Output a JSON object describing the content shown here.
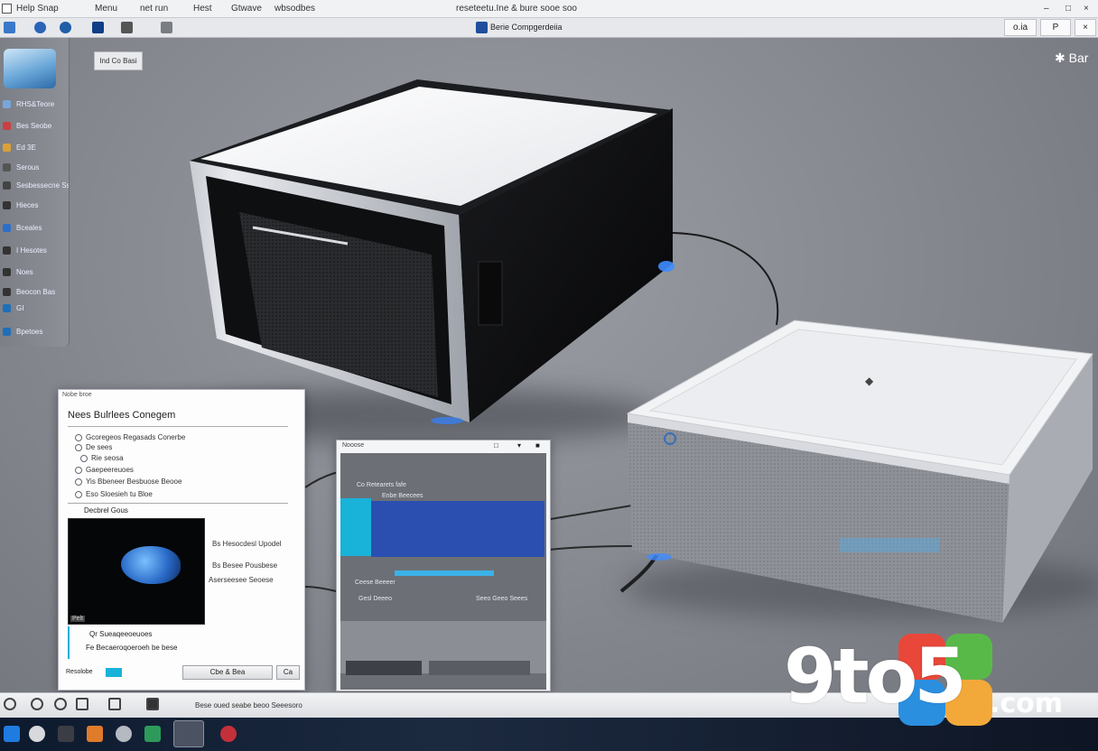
{
  "menubar": {
    "items": [
      "Help Snap",
      "Menu",
      "net run",
      "Hest",
      "Gtwave",
      "wbsodbes"
    ],
    "title": "reseteetu.Ine & bure sooe soo"
  },
  "toolbar": {
    "center_label": "Berie Compgerdeiia",
    "right_dropdown": "o.ia",
    "right_btn2": "P",
    "right_btn3": "×"
  },
  "sidebar": {
    "items": [
      {
        "label": "RHS&Teore",
        "icon_color": "#7aa6d8"
      },
      {
        "label": "Bes Seobe",
        "icon_color": "#c94040"
      },
      {
        "label": "Ed 3E",
        "icon_color": "#d9a13a"
      },
      {
        "label": "Serous",
        "icon_color": "#555"
      },
      {
        "label": "Sesbessecne Ssesce",
        "icon_color": "#444"
      },
      {
        "label": "Hieces",
        "icon_color": "#333"
      },
      {
        "label": "Bceales",
        "icon_color": "#2c6fc9"
      },
      {
        "label": "I Hesotes",
        "icon_color": "#333"
      },
      {
        "label": "Noes",
        "icon_color": "#333"
      },
      {
        "label": "Beocon Bas",
        "icon_color": "#333"
      },
      {
        "label": "GI",
        "icon_color": "#1e6fb8"
      },
      {
        "label": "Bpetoes",
        "icon_color": "#1e6fb8"
      }
    ]
  },
  "view": {
    "label": "Ind Co Basi",
    "badge": "✱ Bar"
  },
  "dialog": {
    "titlebar": "Nobe broe",
    "heading": "Nees Bulrlees Conegem",
    "options": [
      "Gcoregeos Regasads Conerbe",
      "De sees",
      "Rie seosa",
      "Gaepeereuoes",
      "Yis Bbeneer Besbuose Beooe",
      "Eso Sloesieh tu Bloe"
    ],
    "section_label": "Decbrel Gous",
    "side_texts": [
      "Bs Hesocdesl Upodel",
      "Bs Besee Pousbese",
      "Aserseesee Seoese"
    ],
    "preview_caption": "Pelt",
    "footer_line1": "Qr Sueaqeeoeuoes",
    "footer_line2": "Fe Becaeroqoeroeh be bese",
    "footer_left": "Resolobe",
    "button_ok": "Cbe & Bea",
    "button_cancel": "Ca"
  },
  "win2": {
    "title": "Nooose",
    "rows": [
      "Co Retearets fafe",
      "Enbe Beecees",
      "Ceese Beeeer",
      "Gesl Deeeo",
      "Seeo Geeo Seees"
    ],
    "title_icons": [
      "□",
      "▾",
      "■"
    ]
  },
  "statusbar": {
    "text": "Bese oued seabe beoo Seeesoro"
  },
  "watermark": {
    "text": "9to5",
    "suffix": ".com"
  },
  "colors": {
    "accent_blue": "#2a6ac7",
    "cyan": "#19b3d9"
  }
}
